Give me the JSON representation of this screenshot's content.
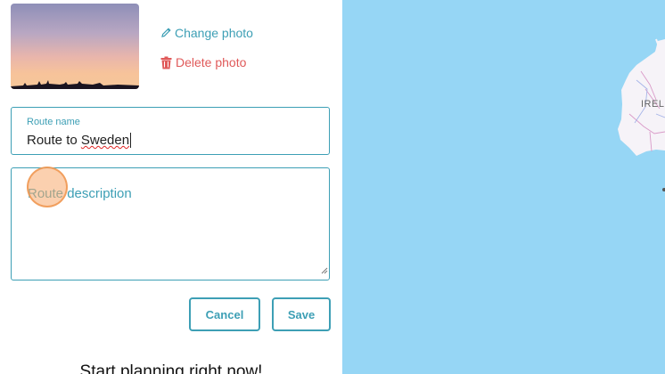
{
  "photo_actions": {
    "change_label": "Change photo",
    "delete_label": "Delete photo"
  },
  "route_form": {
    "name_label": "Route name",
    "name_value_part1": "Route to ",
    "name_value_part2": "Sweden",
    "description_placeholder": "Route description"
  },
  "buttons": {
    "cancel_label": "Cancel",
    "save_label": "Save"
  },
  "promo": {
    "text": "Start planning right now!"
  },
  "map": {
    "country_label": "IREL",
    "water_color": "#96d6f5"
  },
  "colors": {
    "accent": "#3d9fb5",
    "danger": "#e05a5a"
  }
}
